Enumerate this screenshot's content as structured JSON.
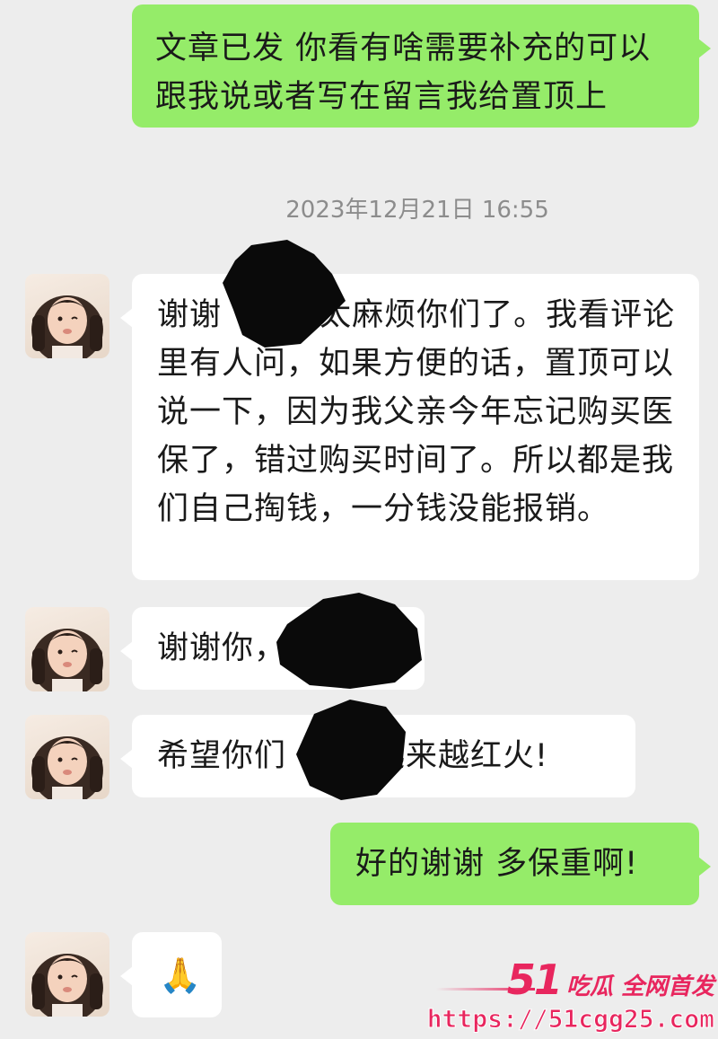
{
  "conversation": {
    "messages": [
      {
        "id": "m1",
        "sender": "me",
        "text": "文章已发 你看有啥需要补充的可以跟我说或者写在留言我给置顶上"
      },
      {
        "id": "m2",
        "sender": "them",
        "text": "谢谢         太麻烦你们了。我看评论里有人问，如果方便的话，置顶可以说一下，因为我父亲今年忘记购买医保了，错过购买时间了。所以都是我们自己掏钱，一分钱没能报销。"
      },
      {
        "id": "m3",
        "sender": "them",
        "text": "谢谢你，"
      },
      {
        "id": "m4",
        "sender": "them",
        "text": "希望你们        越来越红火!"
      },
      {
        "id": "m5",
        "sender": "me",
        "text": "好的谢谢 多保重啊!"
      },
      {
        "id": "m6",
        "sender": "them",
        "text": "🙏"
      }
    ],
    "timestamp": "2023年12月21日 16:55"
  },
  "watermark": {
    "brand_number": "51",
    "brand_text": "吃瓜 全网首发",
    "url": "https://51cgg25.com"
  },
  "colors": {
    "background": "#ededed",
    "outgoing_bubble": "#95ec69",
    "incoming_bubble": "#ffffff",
    "watermark": "#e8265e"
  }
}
